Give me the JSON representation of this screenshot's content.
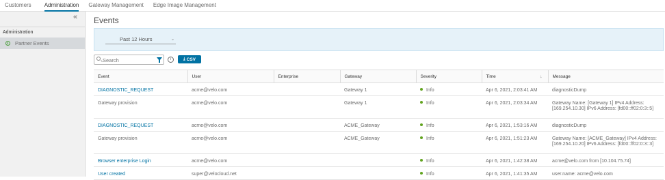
{
  "topnav": {
    "tabs": [
      {
        "label": "Customers"
      },
      {
        "label": "Administration"
      },
      {
        "label": "Gateway Management"
      },
      {
        "label": "Edge Image Management"
      }
    ]
  },
  "sidebar": {
    "section_title": "Administration",
    "items": [
      {
        "label": "Partner Events",
        "icon": "events-icon"
      }
    ]
  },
  "main": {
    "title": "Events",
    "filter": {
      "time_range": "Past 12 Hours"
    },
    "search": {
      "placeholder": "Search"
    },
    "csv_label": "CSV",
    "info_glyph": "i",
    "table": {
      "columns": [
        "Event",
        "User",
        "Enterprise",
        "Gateway",
        "Severity",
        "Time",
        "Message"
      ],
      "rows": [
        {
          "event": "DIAGNOSTIC_REQUEST",
          "user": "acme@velo.com",
          "enterprise": "",
          "gateway": "Gateway 1",
          "severity": "Info",
          "time": "Apr 6, 2021, 2:03:41 AM",
          "message": "diagnosticDump"
        },
        {
          "event": "Gateway provision",
          "user": "acme@velo.com",
          "enterprise": "",
          "gateway": "Gateway 1",
          "severity": "Info",
          "time": "Apr 6, 2021, 2:03:34 AM",
          "message": "Gateway Name: [Gateway 1] IPv4 Address: [169.254.10.30] IPv6 Address: [fd00::ff02:0:3::5]"
        },
        {
          "event": "DIAGNOSTIC_REQUEST",
          "user": "acme@velo.com",
          "enterprise": "",
          "gateway": "ACME_Gateway",
          "severity": "Info",
          "time": "Apr 6, 2021, 1:53:16 AM",
          "message": "diagnosticDump"
        },
        {
          "event": "Gateway provision",
          "user": "acme@velo.com",
          "enterprise": "",
          "gateway": "ACME_Gateway",
          "severity": "Info",
          "time": "Apr 6, 2021, 1:51:23 AM",
          "message": "Gateway Name: [ACME_Gateway] IPv4 Address: [169.254.10.20] IPv6 Address: [fd00::ff02:0:3::3]"
        },
        {
          "event": "Browser enterprise Login",
          "user": "acme@velo.com",
          "enterprise": "",
          "gateway": "",
          "severity": "Info",
          "time": "Apr 6, 2021, 1:42:38 AM",
          "message": "acme@velo.com from [10.104.75.74]"
        },
        {
          "event": "User created",
          "user": "super@velocloud.net",
          "enterprise": "",
          "gateway": "",
          "severity": "Info",
          "time": "Apr 6, 2021, 1:41:35 AM",
          "message": "user.name: acme@velo.com"
        }
      ]
    }
  },
  "colors": {
    "accent": "#0072a3",
    "info_status": "#62a420",
    "sidebar_bg": "#f1f1f1",
    "filter_bg": "#e6f2f9"
  }
}
